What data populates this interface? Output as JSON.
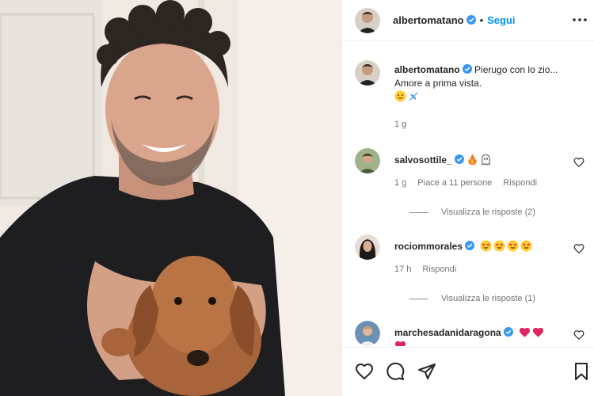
{
  "post": {
    "author": "albertomatano",
    "follow_label": "Segui",
    "separator": "•",
    "photo_alt": "Man smiling holding a small brown dachshund puppy"
  },
  "caption": {
    "author": "albertomatano",
    "line1": "Pierugo con lo zio...",
    "line2": "Amore a prima vista.",
    "emojis": [
      "slightly-smiling-face",
      "airplane"
    ],
    "time": "1 g"
  },
  "comments": [
    {
      "author": "salvosottile_",
      "emojis": [
        "fire",
        "ghost"
      ],
      "time": "1 g",
      "likes_label": "Piace a 11 persone",
      "reply_label": "Rispondi",
      "view_replies": "Visualizza le risposte (2)"
    },
    {
      "author": "rociommorales",
      "emojis": [
        "star-struck",
        "star-struck",
        "star-struck",
        "star-struck"
      ],
      "time": "17 h",
      "reply_label": "Rispondi",
      "view_replies": "Visualizza le risposte (1)"
    },
    {
      "author": "marchesadanidaragona",
      "emojis": [
        "red-heart",
        "red-heart",
        "red-heart"
      ]
    }
  ],
  "colors": {
    "accent": "#0095f6",
    "verified": "#3897f0",
    "text": "#262626",
    "muted": "#737373"
  },
  "icons": [
    "verified-badge-icon",
    "more-options-icon",
    "heart-icon",
    "comment-icon",
    "share-icon",
    "bookmark-icon"
  ]
}
